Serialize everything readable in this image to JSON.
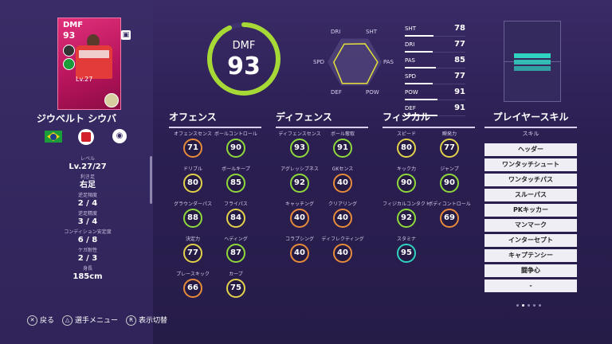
{
  "card": {
    "position": "DMF",
    "rating": "93",
    "level": "Lv.27",
    "frame_color": "#d81f6e"
  },
  "player": {
    "name": "ジウベルト シウバ"
  },
  "info": [
    {
      "label": "レベル",
      "value": "Lv.27/27"
    },
    {
      "label": "利き足",
      "value": "右足"
    },
    {
      "label": "逆足頻度",
      "value": "2 / 4"
    },
    {
      "label": "逆足精度",
      "value": "3 / 4"
    },
    {
      "label": "コンディション安定度",
      "value": "6 / 8"
    },
    {
      "label": "ケガ耐性",
      "value": "2 / 3"
    },
    {
      "label": "身長",
      "value": "185cm"
    }
  ],
  "footer": {
    "back": "戻る",
    "menu": "選手メニュー",
    "toggle": "表示切替"
  },
  "overall": {
    "position": "DMF",
    "rating": "93",
    "ring_color": "#a6d936",
    "ring_fraction": 0.93
  },
  "radar": {
    "labels": [
      "SHT",
      "PAS",
      "POW",
      "DEF",
      "SPD",
      "DRI"
    ],
    "values": [
      78,
      85,
      91,
      91,
      77,
      77
    ],
    "color": "#e3e23a"
  },
  "stats": [
    {
      "label": "SHT",
      "value": "78"
    },
    {
      "label": "DRI",
      "value": "77"
    },
    {
      "label": "PAS",
      "value": "85"
    },
    {
      "label": "SPD",
      "value": "77"
    },
    {
      "label": "POW",
      "value": "91"
    },
    {
      "label": "DEF",
      "value": "91"
    }
  ],
  "sections": {
    "offense": "オフェンス",
    "defense": "ディフェンス",
    "physical": "フィジカル",
    "skills": "プレイヤースキル"
  },
  "offense": [
    {
      "label": "オフェンスセンス",
      "value": "71",
      "tier": "o"
    },
    {
      "label": "ボールコントロール",
      "value": "90",
      "tier": "g"
    },
    {
      "label": "ドリブル",
      "value": "80",
      "tier": "y"
    },
    {
      "label": "ボールキープ",
      "value": "85",
      "tier": "g"
    },
    {
      "label": "グラウンダーパス",
      "value": "88",
      "tier": "g"
    },
    {
      "label": "フライパス",
      "value": "84",
      "tier": "y"
    },
    {
      "label": "決定力",
      "value": "77",
      "tier": "y"
    },
    {
      "label": "ヘディング",
      "value": "87",
      "tier": "g"
    },
    {
      "label": "プレースキック",
      "value": "66",
      "tier": "o"
    },
    {
      "label": "カーブ",
      "value": "75",
      "tier": "y"
    }
  ],
  "defense": [
    {
      "label": "ディフェンスセンス",
      "value": "93",
      "tier": "g"
    },
    {
      "label": "ボール奪取",
      "value": "91",
      "tier": "g"
    },
    {
      "label": "アグレッシブネス",
      "value": "92",
      "tier": "g"
    },
    {
      "label": "GKセンス",
      "value": "40",
      "tier": "o"
    },
    {
      "label": "キャッチング",
      "value": "40",
      "tier": "o"
    },
    {
      "label": "クリアリング",
      "value": "40",
      "tier": "o"
    },
    {
      "label": "コラプシング",
      "value": "40",
      "tier": "o"
    },
    {
      "label": "ディフレクティング",
      "value": "40",
      "tier": "o"
    }
  ],
  "physical": [
    {
      "label": "スピード",
      "value": "80",
      "tier": "y"
    },
    {
      "label": "瞬発力",
      "value": "77",
      "tier": "y"
    },
    {
      "label": "キック力",
      "value": "90",
      "tier": "g"
    },
    {
      "label": "ジャンプ",
      "value": "90",
      "tier": "g"
    },
    {
      "label": "フィジカルコンタクト",
      "value": "92",
      "tier": "g"
    },
    {
      "label": "ボディコントロール",
      "value": "69",
      "tier": "o"
    },
    {
      "label": "スタミナ",
      "value": "95",
      "tier": "t"
    }
  ],
  "skills_header": "スキル",
  "skills": [
    "ヘッダー",
    "ワンタッチシュート",
    "ワンタッチパス",
    "スルーパス",
    "PKキッカー",
    "マンマーク",
    "インターセプト",
    "キャプテンシー",
    "闘争心",
    "-"
  ]
}
